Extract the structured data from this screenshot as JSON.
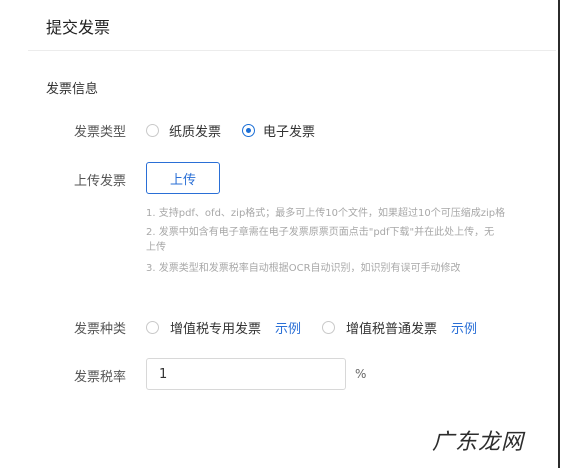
{
  "header": {
    "title": "提交发票"
  },
  "section": {
    "title": "发票信息"
  },
  "invoice_type": {
    "label": "发票类型",
    "options": [
      {
        "label": "纸质发票",
        "checked": false
      },
      {
        "label": "电子发票",
        "checked": true
      }
    ]
  },
  "upload": {
    "label": "上传发票",
    "button": "上传",
    "hints": [
      "1. 支持pdf、ofd、zip格式；最多可上传10个文件，如果超过10个可压缩成zip格",
      "2. 发票中如含有电子章需在电子发票原票页面点击\"pdf下载\"并在此处上传，无",
      "上传",
      "3. 发票类型和发票税率自动根据OCR自动识别，如识别有误可手动修改"
    ]
  },
  "invoice_kind": {
    "label": "发票种类",
    "options": [
      {
        "label": "增值税专用发票",
        "example": "示例",
        "checked": false
      },
      {
        "label": "增值税普通发票",
        "example": "示例",
        "checked": false
      }
    ]
  },
  "tax_rate": {
    "label": "发票税率",
    "value": "1",
    "unit": "%"
  },
  "watermark": "广东龙网",
  "colors": {
    "accent": "#2a6fd6",
    "hint": "#a8a8a8"
  }
}
